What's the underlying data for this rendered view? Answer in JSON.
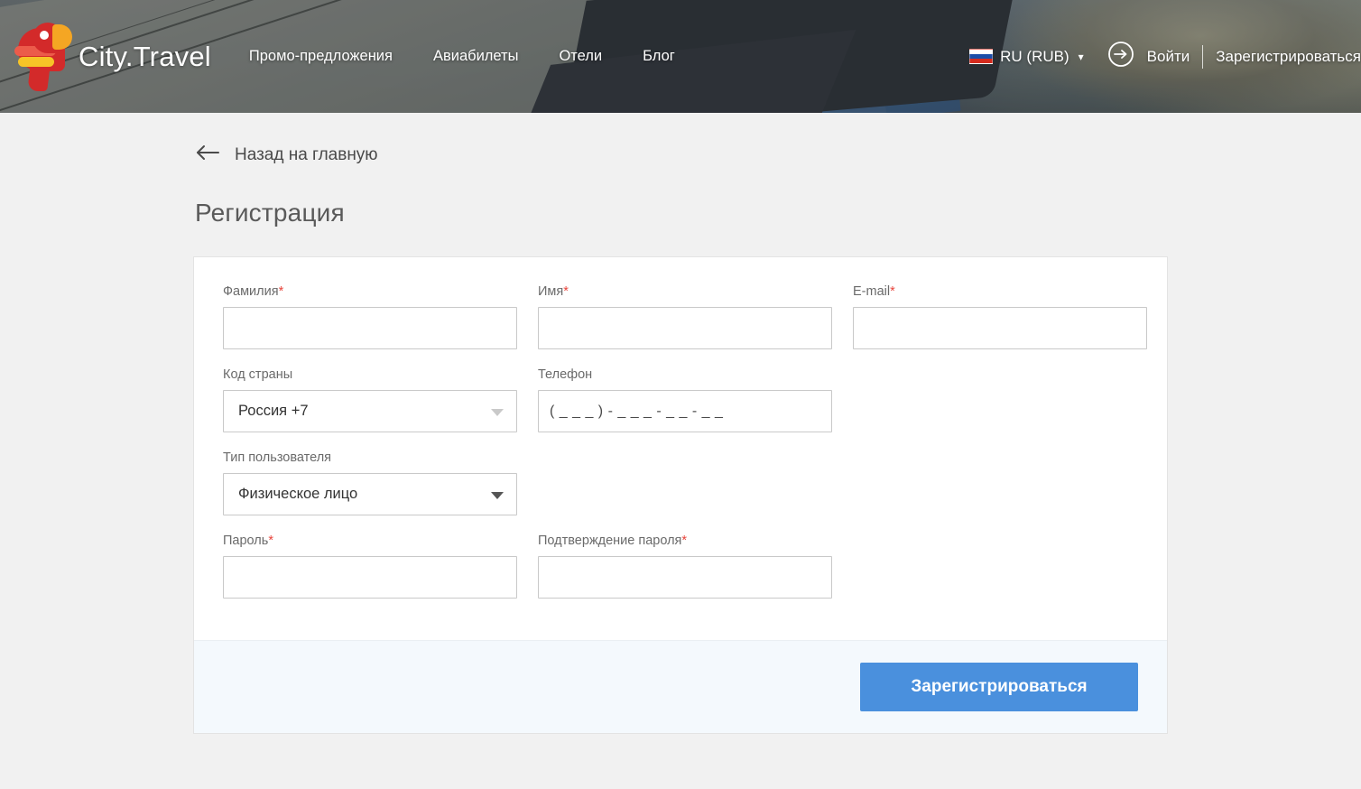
{
  "header": {
    "logo": {
      "icon": "parrot-logo-icon",
      "wordmark": "City.Travel"
    },
    "nav": [
      {
        "label": "Промо-предложения",
        "name": "nav-promo"
      },
      {
        "label": "Авиабилеты",
        "name": "nav-flights"
      },
      {
        "label": "Отели",
        "name": "nav-hotels"
      },
      {
        "label": "Блог",
        "name": "nav-blog"
      }
    ],
    "language": {
      "flag_icon": "russia-flag-icon",
      "label": "RU (RUB)",
      "chevron_icon": "chevron-down-icon"
    },
    "signin_icon": "sign-in-arrow-icon",
    "login_label": "Войти",
    "register_label": "Зарегистрироваться"
  },
  "back_link": {
    "icon": "arrow-left-icon",
    "label": "Назад на главную"
  },
  "page": {
    "title": "Регистрация"
  },
  "form": {
    "fields": {
      "last_name": {
        "label": "Фамилия",
        "required": "*",
        "value": "",
        "placeholder": ""
      },
      "first_name": {
        "label": "Имя",
        "required": "*",
        "value": "",
        "placeholder": ""
      },
      "email": {
        "label": "E-mail",
        "required": "*",
        "value": "",
        "placeholder": ""
      },
      "country_code": {
        "label": "Код страны",
        "value": "Россия +7",
        "caret_icon": "chevron-down-icon"
      },
      "phone": {
        "label": "Телефон",
        "value": "",
        "placeholder": "( _ _ _ ) - _ _ _ - _ _ - _ _"
      },
      "user_type": {
        "label": "Тип пользователя",
        "value": "Физическое лицо",
        "caret_icon": "chevron-down-icon"
      },
      "password": {
        "label": "Пароль",
        "required": "*",
        "value": "",
        "placeholder": ""
      },
      "password_confirm": {
        "label": "Подтверждение пароля",
        "required": "*",
        "value": "",
        "placeholder": ""
      }
    },
    "submit_label": "Зарегистрироваться"
  },
  "colors": {
    "accent_blue": "#4a90dd",
    "required_red": "#e8453c",
    "page_background": "#f1f1f1",
    "card_footer": "#f4f9fd",
    "logo_red": "#d32a2a",
    "logo_orange": "#f5a623",
    "logo_yellow": "#f7c427"
  }
}
